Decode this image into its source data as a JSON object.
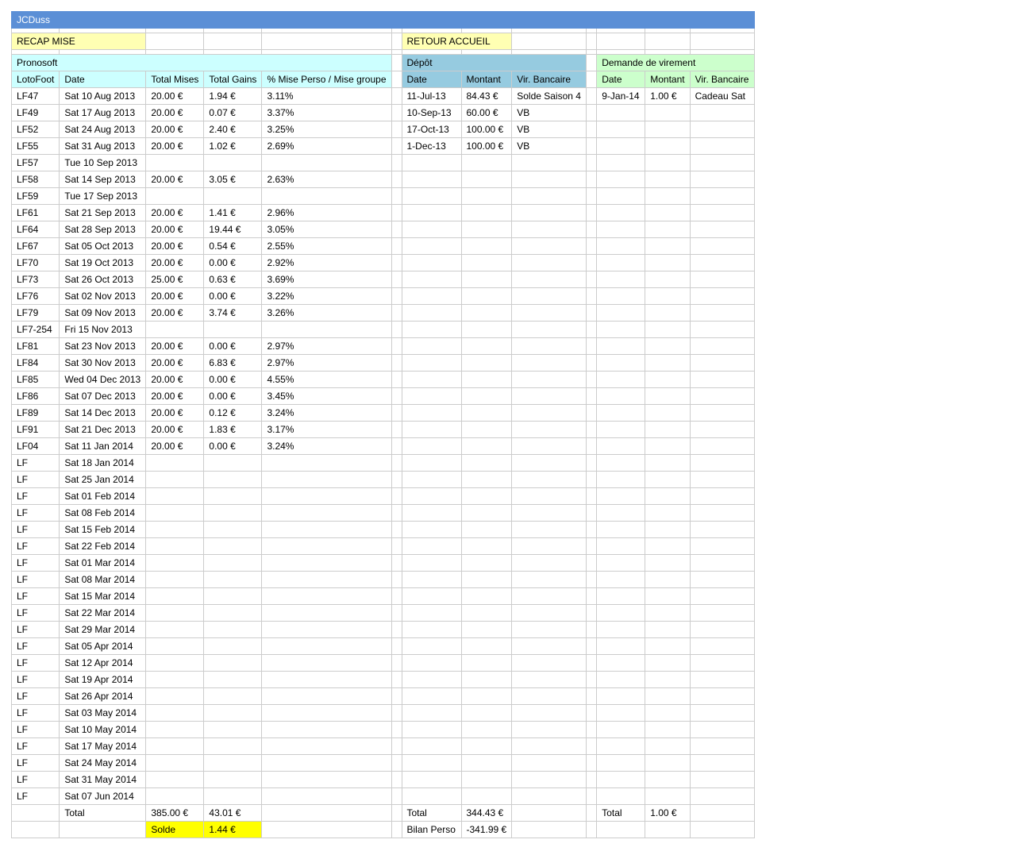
{
  "title": "JCDuss",
  "buttons": {
    "recap": "RECAP MISE",
    "retour": "RETOUR ACCUEIL"
  },
  "sections": {
    "pronosoft": "Pronosoft",
    "depot": "Dépôt",
    "demande": "Demande de virement"
  },
  "headers": {
    "lotofoot": "LotoFoot",
    "date": "Date",
    "total_mises": "Total Mises",
    "total_gains": "Total Gains",
    "pct": "% Mise Perso / Mise groupe",
    "dep_date": "Date",
    "dep_montant": "Montant",
    "dep_vir": "Vir. Bancaire",
    "dem_date": "Date",
    "dem_montant": "Montant",
    "dem_vir": "Vir. Bancaire"
  },
  "loto_rows": [
    [
      "LF47",
      "Sat 10 Aug 2013",
      "20.00 €",
      "1.94 €",
      "3.11%"
    ],
    [
      "LF49",
      "Sat 17 Aug 2013",
      "20.00 €",
      "0.07 €",
      "3.37%"
    ],
    [
      "LF52",
      "Sat 24 Aug 2013",
      "20.00 €",
      "2.40 €",
      "3.25%"
    ],
    [
      "LF55",
      "Sat 31 Aug 2013",
      "20.00 €",
      "1.02 €",
      "2.69%"
    ],
    [
      "LF57",
      "Tue 10 Sep 2013",
      "",
      "",
      ""
    ],
    [
      "LF58",
      "Sat 14 Sep 2013",
      "20.00 €",
      "3.05 €",
      "2.63%"
    ],
    [
      "LF59",
      "Tue 17 Sep 2013",
      "",
      "",
      ""
    ],
    [
      "LF61",
      "Sat 21 Sep 2013",
      "20.00 €",
      "1.41 €",
      "2.96%"
    ],
    [
      "LF64",
      "Sat 28 Sep 2013",
      "20.00 €",
      "19.44 €",
      "3.05%"
    ],
    [
      "LF67",
      "Sat 05 Oct 2013",
      "20.00 €",
      "0.54 €",
      "2.55%"
    ],
    [
      "LF70",
      "Sat 19 Oct 2013",
      "20.00 €",
      "0.00 €",
      "2.92%"
    ],
    [
      "LF73",
      "Sat 26 Oct 2013",
      "25.00 €",
      "0.63 €",
      "3.69%"
    ],
    [
      "LF76",
      "Sat 02 Nov 2013",
      "20.00 €",
      "0.00 €",
      "3.22%"
    ],
    [
      "LF79",
      "Sat 09 Nov 2013",
      "20.00 €",
      "3.74 €",
      "3.26%"
    ],
    [
      "LF7-254",
      "Fri 15 Nov 2013",
      "",
      "",
      ""
    ],
    [
      "LF81",
      "Sat 23 Nov 2013",
      "20.00 €",
      "0.00 €",
      "2.97%"
    ],
    [
      "LF84",
      "Sat 30 Nov 2013",
      "20.00 €",
      "6.83 €",
      "2.97%"
    ],
    [
      "LF85",
      "Wed 04 Dec 2013",
      "20.00 €",
      "0.00 €",
      "4.55%"
    ],
    [
      "LF86",
      "Sat 07 Dec 2013",
      "20.00 €",
      "0.00 €",
      "3.45%"
    ],
    [
      "LF89",
      "Sat 14 Dec 2013",
      "20.00 €",
      "0.12 €",
      "3.24%"
    ],
    [
      "LF91",
      "Sat 21 Dec 2013",
      "20.00 €",
      "1.83 €",
      "3.17%"
    ],
    [
      "LF04",
      "Sat 11 Jan 2014",
      "20.00 €",
      "0.00 €",
      "3.24%"
    ],
    [
      "LF",
      "Sat 18 Jan 2014",
      "",
      "",
      ""
    ],
    [
      "LF",
      "Sat 25 Jan 2014",
      "",
      "",
      ""
    ],
    [
      "LF",
      "Sat 01 Feb 2014",
      "",
      "",
      ""
    ],
    [
      "LF",
      "Sat 08 Feb 2014",
      "",
      "",
      ""
    ],
    [
      "LF",
      "Sat 15 Feb 2014",
      "",
      "",
      ""
    ],
    [
      "LF",
      "Sat 22 Feb 2014",
      "",
      "",
      ""
    ],
    [
      "LF",
      "Sat 01 Mar 2014",
      "",
      "",
      ""
    ],
    [
      "LF",
      "Sat 08 Mar 2014",
      "",
      "",
      ""
    ],
    [
      "LF",
      "Sat 15 Mar 2014",
      "",
      "",
      ""
    ],
    [
      "LF",
      "Sat 22 Mar 2014",
      "",
      "",
      ""
    ],
    [
      "LF",
      "Sat 29 Mar 2014",
      "",
      "",
      ""
    ],
    [
      "LF",
      "Sat 05 Apr 2014",
      "",
      "",
      ""
    ],
    [
      "LF",
      "Sat 12 Apr 2014",
      "",
      "",
      ""
    ],
    [
      "LF",
      "Sat 19 Apr 2014",
      "",
      "",
      ""
    ],
    [
      "LF",
      "Sat 26 Apr 2014",
      "",
      "",
      ""
    ],
    [
      "LF",
      "Sat 03 May 2014",
      "",
      "",
      ""
    ],
    [
      "LF",
      "Sat 10 May 2014",
      "",
      "",
      ""
    ],
    [
      "LF",
      "Sat 17 May 2014",
      "",
      "",
      ""
    ],
    [
      "LF",
      "Sat 24 May 2014",
      "",
      "",
      ""
    ],
    [
      "LF",
      "Sat 31 May 2014",
      "",
      "",
      ""
    ],
    [
      "LF",
      "Sat 07 Jun 2014",
      "",
      "",
      ""
    ]
  ],
  "depot_rows": [
    [
      "11-Jul-13",
      "84.43 €",
      "Solde Saison 4"
    ],
    [
      "10-Sep-13",
      "60.00 €",
      "VB"
    ],
    [
      "17-Oct-13",
      "100.00 €",
      "VB"
    ],
    [
      "1-Dec-13",
      "100.00 €",
      "VB"
    ]
  ],
  "demande_rows": [
    [
      "9-Jan-14",
      "1.00 €",
      "Cadeau Sat"
    ]
  ],
  "totals": {
    "label": "Total",
    "mises": "385.00 €",
    "gains": "43.01 €",
    "depot_label": "Total",
    "depot_value": "344.43 €",
    "demande_label": "Total",
    "demande_value": "1.00 €"
  },
  "solde": {
    "label": "Solde",
    "value": "1.44 €",
    "bilan_label": "Bilan Perso",
    "bilan_value": "-341.99 €"
  },
  "colors": {
    "title_bar": "#5b8fd6",
    "button": "#ffffb3",
    "pronosoft": "#ccffff",
    "depot": "#96cbe0",
    "demande": "#ccffcc",
    "solde": "#ffff00"
  }
}
